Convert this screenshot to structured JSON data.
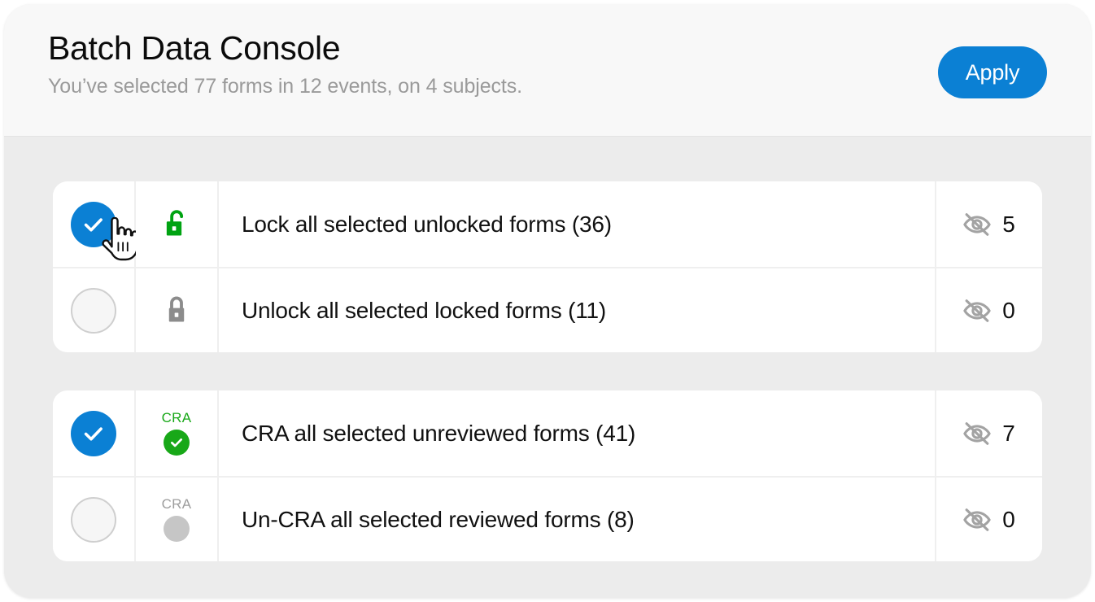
{
  "header": {
    "title": "Batch Data Console",
    "subtitle": "You’ve selected 77 forms in 12 events, on 4 subjects.",
    "apply_label": "Apply"
  },
  "colors": {
    "accent_blue": "#0b80d4",
    "green": "#18a818",
    "grey": "#8c8c8c",
    "grey_light": "#c6c6c6",
    "card_bg": "#ececec",
    "header_bg": "#f8f8f8",
    "row_bg": "#ffffff"
  },
  "groups": [
    {
      "name": "lock-group",
      "rows": [
        {
          "checked": true,
          "check_icon": "check-circle-filled-icon",
          "status_icon": "unlock-icon",
          "label": "Lock all selected unlocked forms (36)",
          "count_icon": "eye-off-icon",
          "count": "5"
        },
        {
          "checked": false,
          "check_icon": "circle-empty-icon",
          "status_icon": "lock-icon",
          "label": "Unlock all selected locked forms (11)",
          "count_icon": "eye-off-icon",
          "count": "0"
        }
      ]
    },
    {
      "name": "cra-group",
      "rows": [
        {
          "checked": true,
          "check_icon": "check-circle-filled-icon",
          "status_icon": "cra-reviewed-icon",
          "status_text": "CRA",
          "label": "CRA all selected unreviewed forms (41)",
          "count_icon": "eye-off-icon",
          "count": "7"
        },
        {
          "checked": false,
          "check_icon": "circle-empty-icon",
          "status_icon": "cra-unreviewed-icon",
          "status_text": "CRA",
          "label": "Un-CRA all selected reviewed forms (8)",
          "count_icon": "eye-off-icon",
          "count": "0"
        }
      ]
    }
  ],
  "cursor": {
    "icon": "pointing-hand-cursor",
    "on_row": 0
  }
}
